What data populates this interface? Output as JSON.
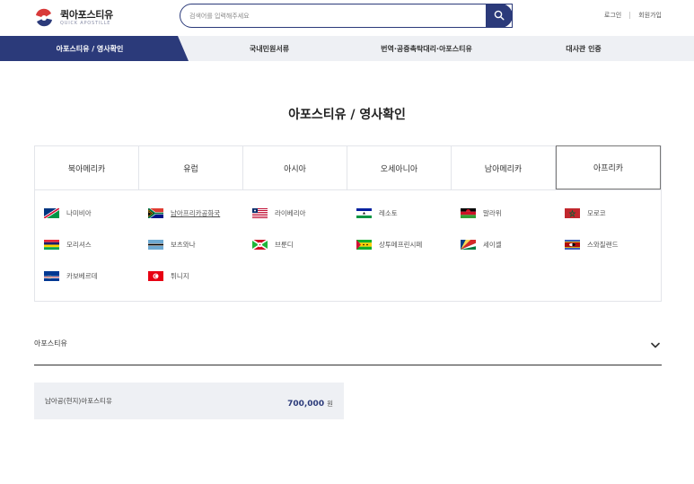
{
  "header": {
    "logo_main": "퀵아포스티유",
    "logo_sub": "QUICK APOSTILLE",
    "search_placeholder": "검색어를 입력해주세요",
    "login": "로그인",
    "signup": "회원가입"
  },
  "nav": {
    "items": [
      {
        "label": "아포스티유 / 영사확인",
        "active": true
      },
      {
        "label": "국내민원서류",
        "active": false
      },
      {
        "label": "번역·공증촉탁대리·아포스티유",
        "active": false
      },
      {
        "label": "대사관 인증",
        "active": false
      }
    ]
  },
  "page": {
    "title": "아포스티유 / 영사확인"
  },
  "regions": {
    "tabs": [
      "북아메리카",
      "유럽",
      "아시아",
      "오세아니아",
      "남아메리카",
      "아프리카"
    ],
    "active": "아프리카"
  },
  "countries": [
    {
      "name": "나미비아",
      "flag": "namibia"
    },
    {
      "name": "남아프리카공화국",
      "flag": "south-africa",
      "underline": true
    },
    {
      "name": "라이베리아",
      "flag": "liberia"
    },
    {
      "name": "레소토",
      "flag": "lesotho"
    },
    {
      "name": "말라위",
      "flag": "malawi"
    },
    {
      "name": "모로코",
      "flag": "morocco"
    },
    {
      "name": "모리셔스",
      "flag": "mauritius"
    },
    {
      "name": "보츠와나",
      "flag": "botswana"
    },
    {
      "name": "브룬디",
      "flag": "burundi"
    },
    {
      "name": "상투메프린시페",
      "flag": "sao-tome"
    },
    {
      "name": "세이셸",
      "flag": "seychelles"
    },
    {
      "name": "스와질랜드",
      "flag": "eswatini"
    },
    {
      "name": "카보베르데",
      "flag": "cape-verde"
    },
    {
      "name": "튀니지",
      "flag": "tunisia"
    }
  ],
  "accordion": {
    "title": "아포스티유"
  },
  "price": {
    "name": "남아공(현지)아포스티유",
    "value": "700,000",
    "unit": "원"
  },
  "colors": {
    "brand": "#2b3a7a",
    "nav_bg": "#eef0f4"
  }
}
